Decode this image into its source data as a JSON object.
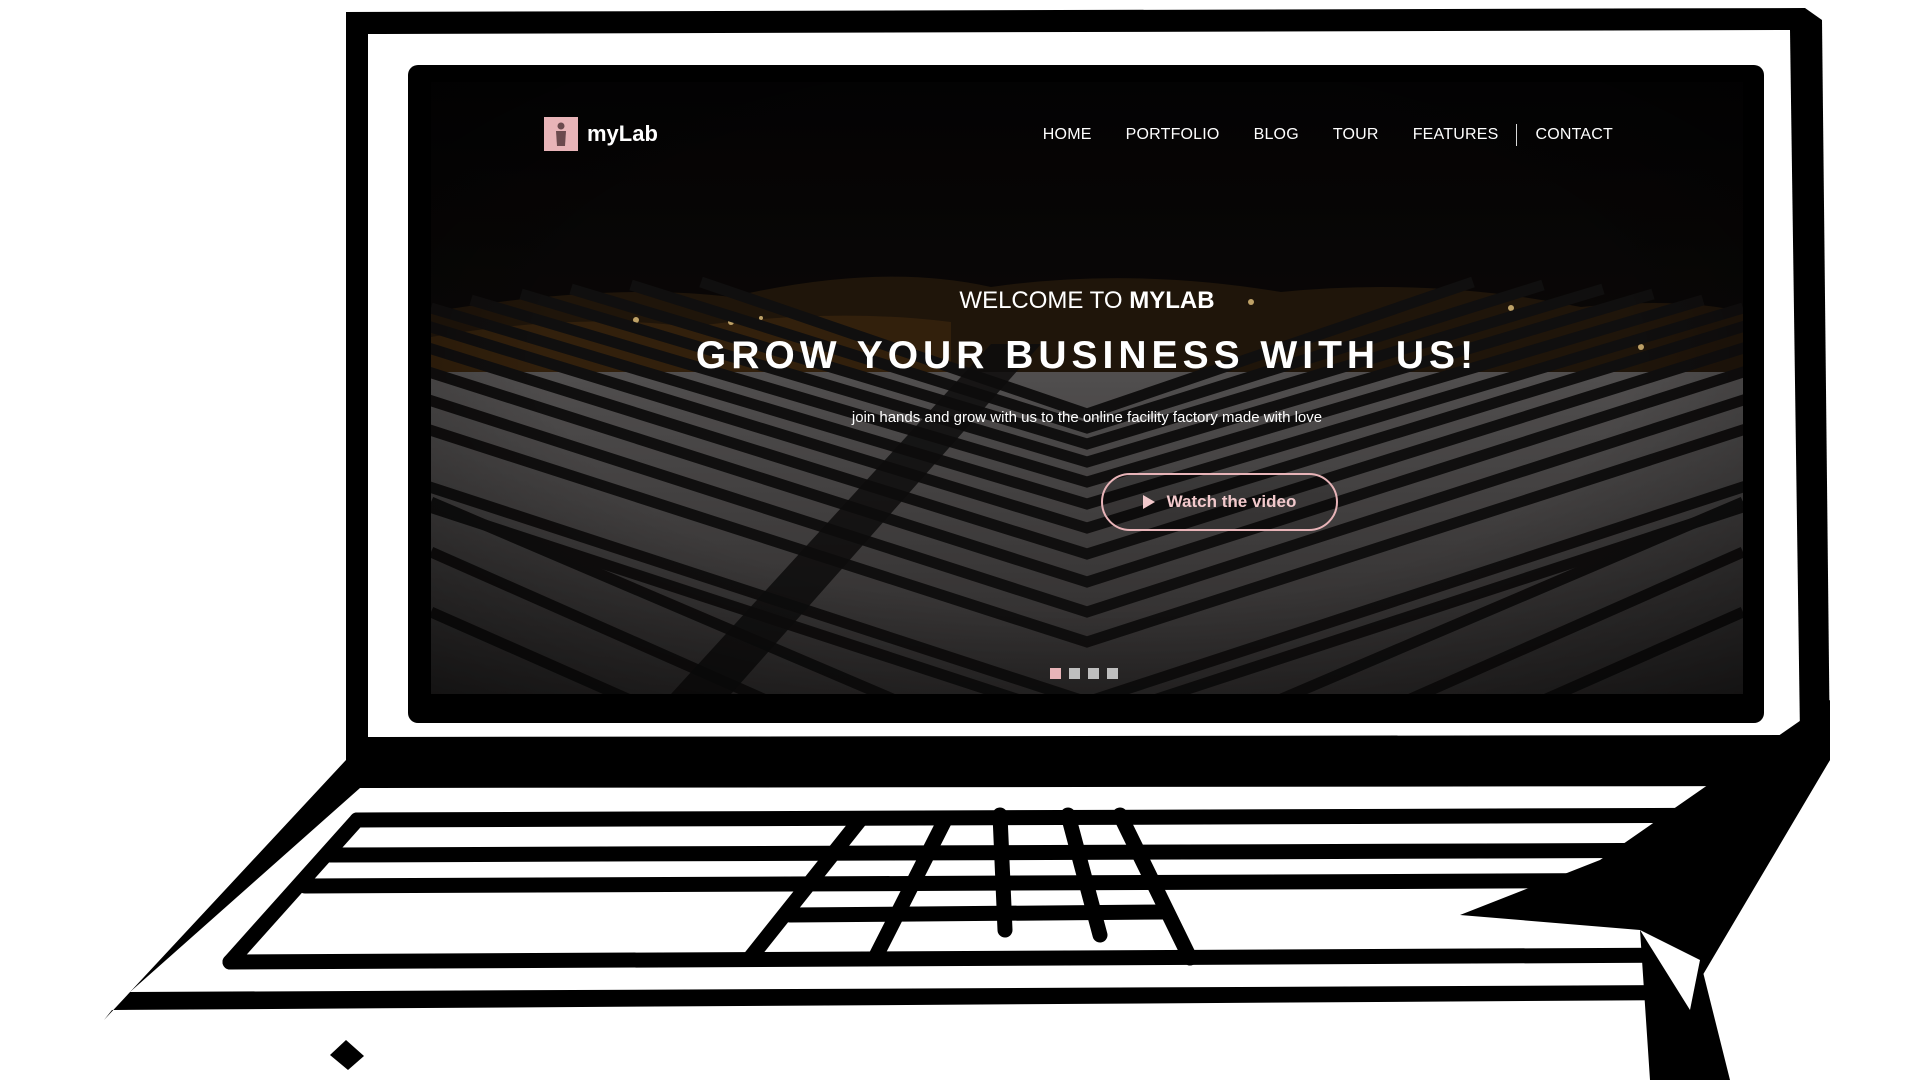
{
  "site": {
    "brand": "myLab",
    "nav": [
      "HOME",
      "PORTFOLIO",
      "BLOG",
      "TOUR",
      "FEATURES",
      "CONTACT"
    ]
  },
  "hero": {
    "welcome_prefix": "WELCOME TO",
    "welcome_brand": "MYLAB",
    "headline": "GROW YOUR BUSINESS WITH US!",
    "tagline": "join hands and grow with us to the online facility factory made with love",
    "cta_label": "Watch the video",
    "slides": 4,
    "active_slide": 1
  },
  "colors": {
    "accent": "#e8b4b8",
    "cta_text": "#f2c9cc",
    "text": "#ffffff",
    "laptop_line": "#000000"
  },
  "icons": {
    "logo": "person-silhouette-icon",
    "cta": "play-icon"
  }
}
